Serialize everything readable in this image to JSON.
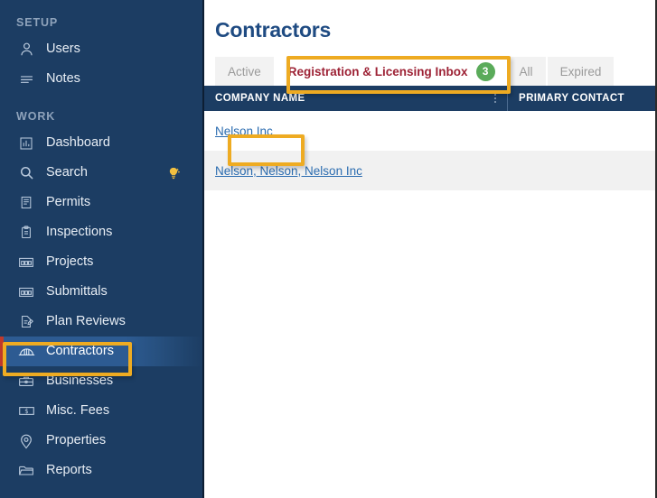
{
  "sidebar": {
    "sections": [
      {
        "label": "SETUP",
        "items": [
          {
            "label": "Users",
            "icon": "user-icon"
          },
          {
            "label": "Notes",
            "icon": "notes-icon"
          }
        ]
      },
      {
        "label": "WORK",
        "items": [
          {
            "label": "Dashboard",
            "icon": "dashboard-icon"
          },
          {
            "label": "Search",
            "icon": "search-icon",
            "badge_icon": "lightbulb-icon"
          },
          {
            "label": "Permits",
            "icon": "permits-icon"
          },
          {
            "label": "Inspections",
            "icon": "clipboard-icon"
          },
          {
            "label": "Projects",
            "icon": "projects-icon"
          },
          {
            "label": "Submittals",
            "icon": "submittals-icon"
          },
          {
            "label": "Plan Reviews",
            "icon": "plan-review-icon"
          },
          {
            "label": "Contractors",
            "icon": "hardhat-icon",
            "active": true
          },
          {
            "label": "Businesses",
            "icon": "briefcase-icon"
          },
          {
            "label": "Misc. Fees",
            "icon": "money-icon"
          },
          {
            "label": "Properties",
            "icon": "map-pin-icon"
          },
          {
            "label": "Reports",
            "icon": "folder-icon"
          }
        ]
      }
    ]
  },
  "main": {
    "page_title": "Contractors",
    "tabs": [
      {
        "label": "Active",
        "selected": false
      },
      {
        "label": "Registration & Licensing Inbox",
        "count": "3",
        "selected": true
      },
      {
        "label": "All",
        "selected": false
      },
      {
        "label": "Expired",
        "selected": false
      }
    ],
    "table": {
      "columns": [
        {
          "key": "company",
          "label": "COMPANY NAME"
        },
        {
          "key": "contact",
          "label": "PRIMARY CONTACT"
        }
      ],
      "rows": [
        {
          "company": "Nelson Inc",
          "contact": ""
        },
        {
          "company": "Nelson, Nelson, Nelson Inc",
          "contact": ""
        }
      ]
    }
  },
  "colors": {
    "sidebar_bg": "#1c3d63",
    "sidebar_active": "#2d5b92",
    "active_marker": "#c0392b",
    "title_blue": "#1f4b82",
    "tab_selected_text": "#9d2235",
    "badge_green": "#5aab5a",
    "link_blue": "#2b6cb0",
    "highlight_gold": "#eeab22"
  },
  "annotations": [
    {
      "name": "contractors-nav-highlight",
      "target": "Contractors"
    },
    {
      "name": "registration-tab-highlight",
      "target": "Registration & Licensing Inbox"
    },
    {
      "name": "nelson-inc-link-highlight",
      "target": "Nelson Inc"
    }
  ]
}
